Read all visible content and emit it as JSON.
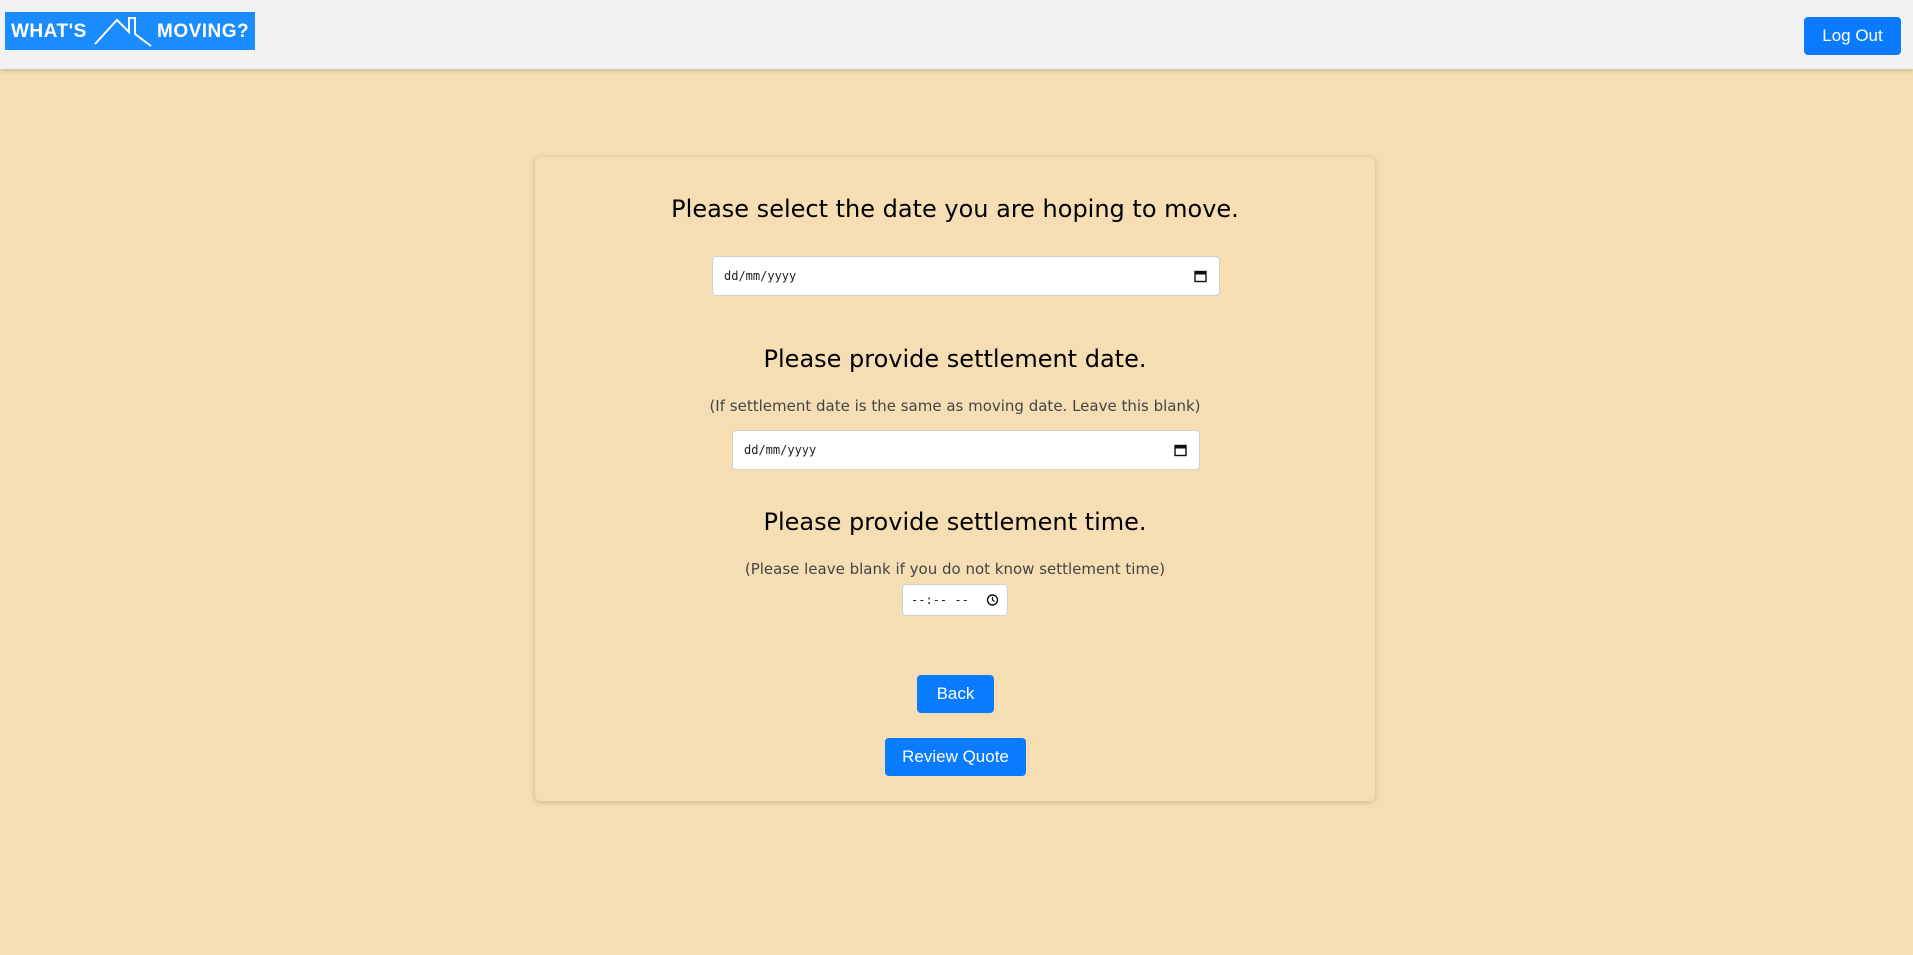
{
  "header": {
    "logo_left": "WHAT'S",
    "logo_right": "MOVING?",
    "logout_label": "Log Out"
  },
  "form": {
    "move_date": {
      "heading": "Please select the date you are hoping to move.",
      "placeholder": "dd/mm/yyyy",
      "icon": "calendar-icon"
    },
    "settlement_date": {
      "heading": "Please provide settlement date.",
      "note": "(If settlement date is the same as moving date. Leave this blank)",
      "placeholder": "dd/mm/yyyy",
      "icon": "calendar-icon"
    },
    "settlement_time": {
      "heading": "Please provide settlement time.",
      "note": "(Please leave blank if you do not know settlement time)",
      "placeholder": "--:-- --",
      "icon": "clock-icon"
    },
    "back_label": "Back",
    "review_label": "Review Quote"
  },
  "colors": {
    "background": "#f5deb3",
    "topbar": "#f2f2f2",
    "accent": "#0a7bff",
    "logo_bg": "#1a8cff"
  }
}
